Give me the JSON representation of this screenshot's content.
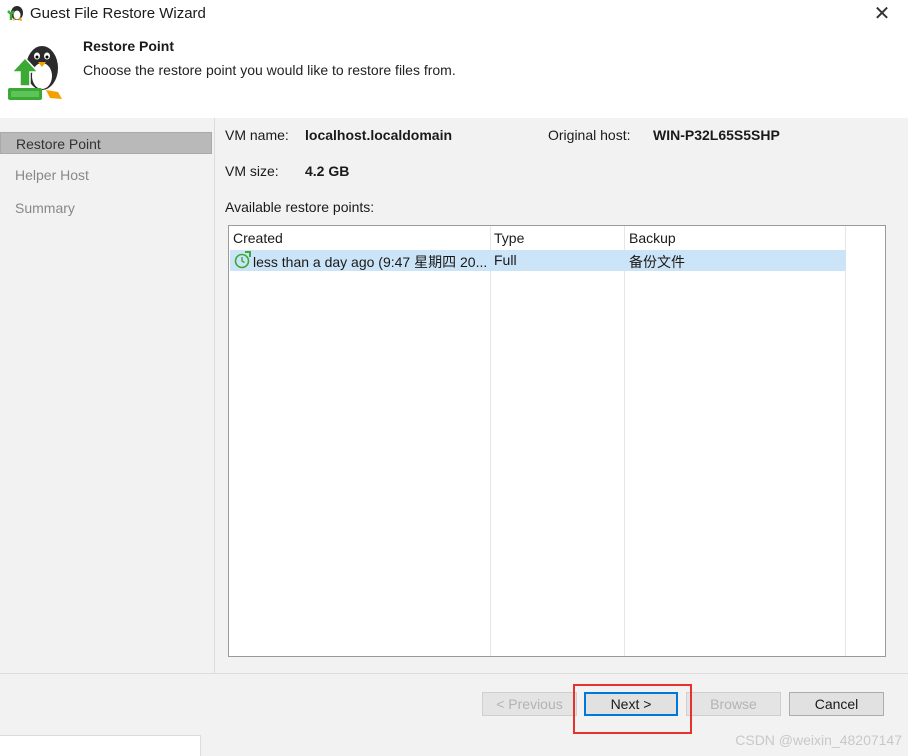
{
  "window": {
    "title": "Guest File Restore Wizard",
    "close_label": "✕"
  },
  "header": {
    "title": "Restore Point",
    "subtitle": "Choose the restore point you would like to restore files from."
  },
  "sidebar": {
    "items": [
      {
        "label": "Restore Point",
        "active": true
      },
      {
        "label": "Helper Host",
        "active": false
      },
      {
        "label": "Summary",
        "active": false
      }
    ]
  },
  "vm": {
    "name_label": "VM name:",
    "name_value": "localhost.localdomain",
    "host_label": "Original host:",
    "host_value": "WIN-P32L65S5SHP",
    "size_label": "VM size:",
    "size_value": "4.2 GB"
  },
  "restore_points": {
    "label": "Available restore points:",
    "columns": [
      "Created",
      "Type",
      "Backup"
    ],
    "rows": [
      {
        "created": "less than a day ago (9:47 星期四 20...",
        "type": "Full",
        "backup": "备份文件",
        "icon": "restore-point-clock-icon"
      }
    ]
  },
  "buttons": {
    "previous": "< Previous",
    "next": "Next >",
    "browse": "Browse",
    "cancel": "Cancel"
  },
  "watermark": "CSDN @weixin_48207147",
  "colors": {
    "accent": "#0078d7",
    "selected_row": "#cce4f7",
    "highlight": "#e5322d",
    "icon_green": "#3aaa35"
  }
}
